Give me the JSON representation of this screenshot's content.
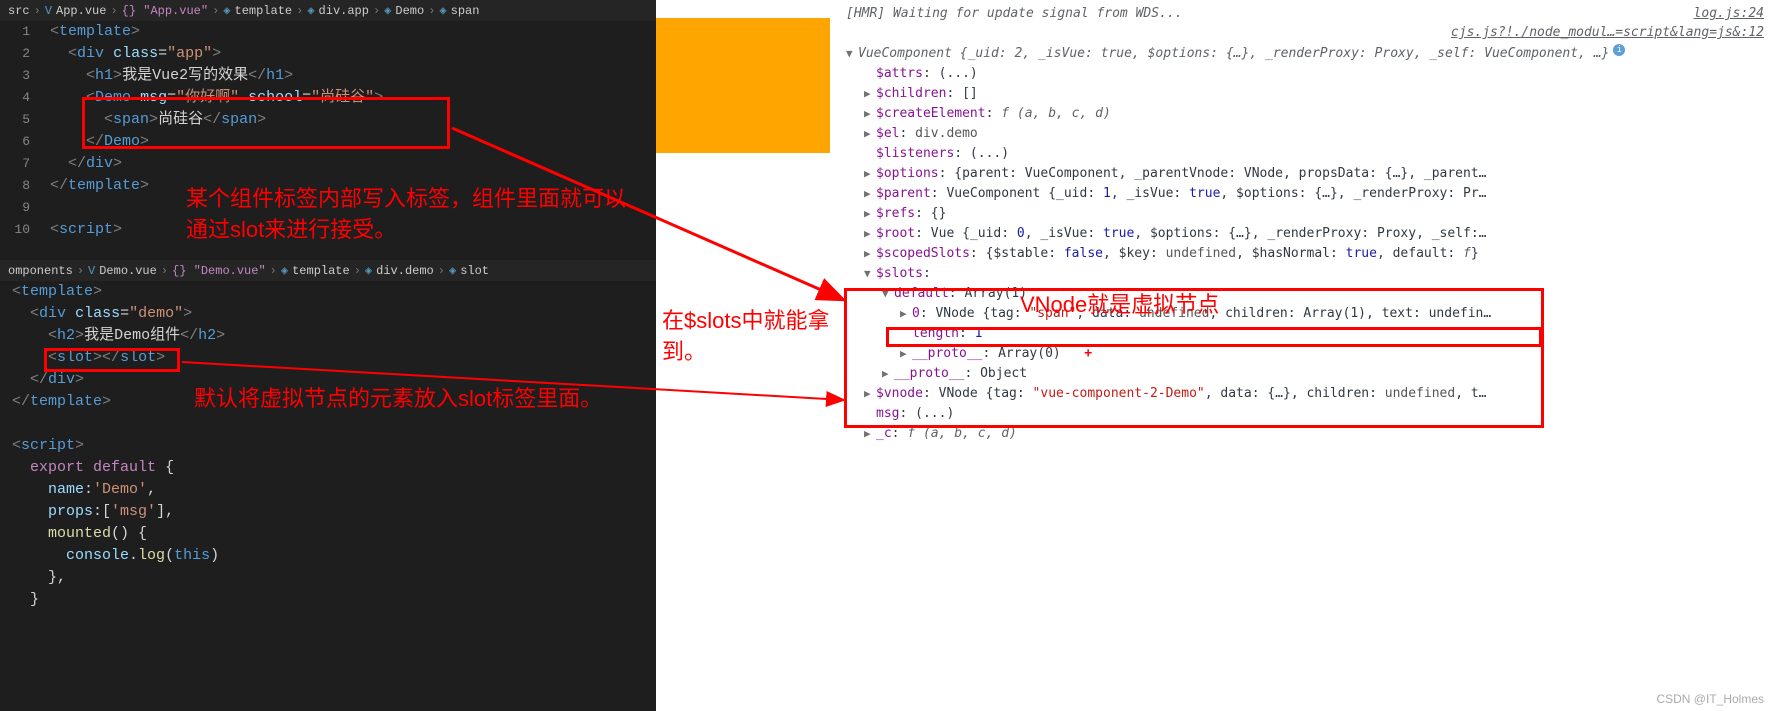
{
  "editor_top": {
    "breadcrumb": [
      "src",
      "App.vue",
      "{} \"App.vue\"",
      "template",
      "div.app",
      "Demo",
      "span"
    ],
    "lines": [
      1,
      2,
      3,
      4,
      5,
      6,
      7,
      8,
      9,
      10
    ],
    "code": {
      "l1": "<template>",
      "l2": "  <div class=\"app\">",
      "l3": "    <h1>我是Vue2写的效果</h1>",
      "l4": "    <Demo msg=\"你好啊\" school=\"尚硅谷\">",
      "l5": "      <span>尚硅谷</span>",
      "l6": "    </Demo>",
      "l7": "  </div>",
      "l8": "</template>",
      "l9": "",
      "l10": "<script>"
    }
  },
  "editor_bottom": {
    "breadcrumb": [
      "omponents",
      "Demo.vue",
      "{} \"Demo.vue\"",
      "template",
      "div.demo",
      "slot"
    ],
    "code": {
      "l1": "<template>",
      "l2": "  <div class=\"demo\">",
      "l3": "    <h2>我是Demo组件</h2>",
      "l4": "    <slot></slot>",
      "l5": "  </div>",
      "l6": "</template>",
      "l7": "",
      "l8": "<script>",
      "l9": "  export default {",
      "l10": "    name:'Demo',",
      "l11": "    props:['msg'],",
      "l12": "    mounted() {",
      "l13": "      console.log(this)",
      "l14": "    },",
      "l15": "  }"
    }
  },
  "annotations": {
    "top": "某个组件标签内部写入标签，组件里面就可以通过slot来进行接受。",
    "bottom": "默认将虚拟节点的元素放入slot标签里面。",
    "mid": "在$slots中就能拿到。",
    "vnode": "VNode就是虚拟节点"
  },
  "devtools": {
    "hmr": "[HMR] Waiting for update signal from WDS...",
    "hmr_link": "log.js:24",
    "source_link": "cjs.js?!./node_modul…=script&lang=js&:12",
    "root_label": "VueComponent {_uid: 2, _isVue: true, $options: {…}, _renderProxy: Proxy, _self: VueComponent, …}",
    "props": {
      "attrs": "$attrs: (...)",
      "children": "$children: []",
      "createElement": "$createElement: f (a, b, c, d)",
      "el": "$el: div.demo",
      "listeners": "$listeners: (...)",
      "options": "$options: {parent: VueComponent, _parentVnode: VNode, propsData: {…}, _parent…",
      "parent": "$parent: VueComponent {_uid: 1, _isVue: true, $options: {…}, _renderProxy: Pr…",
      "refs": "$refs: {}",
      "root": "$root: Vue {_uid: 0, _isVue: true, $options: {…}, _renderProxy: Proxy, _self:…",
      "scopedSlots": "$scopedSlots: {$stable: false, $key: undefined, $hasNormal: true, default: f}",
      "slots": "$slots:",
      "default_arr": "default: Array(1)",
      "item0": "0: VNode {tag: \"span\", data: undefined, children: Array(1), text: undefin…",
      "length": "length: 1",
      "proto_arr": "__proto__: Array(0)",
      "proto_obj": "__proto__: Object",
      "vnode": "$vnode: VNode {tag: \"vue-component-2-Demo\", data: {…}, children: undefined, t…",
      "msg": "msg: (...)",
      "c": "_c: f (a, b, c, d)"
    }
  },
  "watermark": "CSDN @IT_Holmes"
}
